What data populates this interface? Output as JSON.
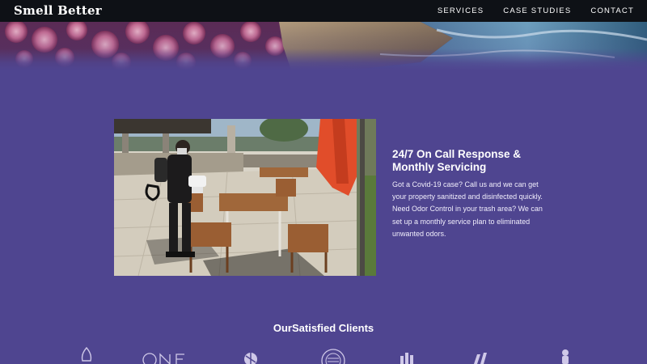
{
  "header": {
    "logo": "Smell Better",
    "nav": [
      {
        "label": "SERVICES"
      },
      {
        "label": "CASE STUDIES"
      },
      {
        "label": "CONTACT"
      }
    ]
  },
  "feature": {
    "title": "24/7 On Call Response & Monthly Servicing",
    "body": "Got a Covid-19 case? Call us and we can get your property sanitized and disinfected quickly. Need Odor Control in your trash area? We can set up a monthly service plan to eliminated unwanted odors."
  },
  "clients": {
    "title": "OurSatisfied Clients",
    "logos": [
      "flame-logo",
      "one-logo",
      "circle-logo",
      "seal-logo",
      "building-logo",
      "stripes-logo",
      "figure-logo"
    ]
  },
  "colors": {
    "background": "#4f4590",
    "navbar": "#0e1116",
    "text": "#ffffff"
  }
}
